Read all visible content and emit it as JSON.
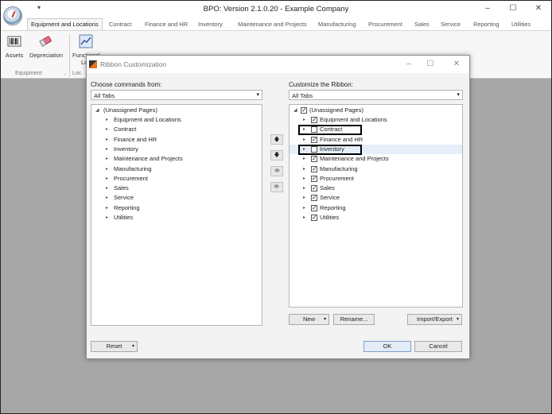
{
  "app": {
    "title": "BPO: Version 2.1.0.20 - Example Company",
    "qat_glyph": "▾",
    "minimize": "–",
    "maximize": "☐",
    "close": "✕"
  },
  "tabs": [
    "Equipment and Locations",
    "Contract",
    "Finance and HR",
    "Inventory",
    "Maintenance and Projects",
    "Manufacturing",
    "Procurement",
    "Sales",
    "Service",
    "Reporting",
    "Utilities"
  ],
  "ribbon": {
    "assets_label": "Assets",
    "depreciation_label": "Depreciation",
    "functional_label_1": "Functional",
    "functional_label_2": "Loc",
    "group_equipment": "Equipment",
    "group_loc": "Loc"
  },
  "dialog": {
    "title": "Ribbon Customization",
    "minimize": "–",
    "maximize": "☐",
    "close": "✕",
    "left_label": "Choose commands from:",
    "left_combo": "All Tabs",
    "right_label": "Customize the Ribbon:",
    "right_combo": "All Tabs",
    "combo_arrow": "▾",
    "left_tree": {
      "root": "(Unassigned Pages)",
      "items": [
        "Equipment and Locations",
        "Contract",
        "Finance and HR",
        "Inventory",
        "Maintenance and Projects",
        "Manufacturing",
        "Procurement",
        "Sales",
        "Service",
        "Reporting",
        "Utilities"
      ]
    },
    "right_tree": {
      "root": "(Unassigned Pages)",
      "root_checked": true,
      "items": [
        {
          "label": "Equipment and Locations",
          "checked": true
        },
        {
          "label": "Contract",
          "checked": false
        },
        {
          "label": "Finance and HR",
          "checked": true
        },
        {
          "label": "Inventory",
          "checked": false
        },
        {
          "label": "Maintenance and Projects",
          "checked": true
        },
        {
          "label": "Manufacturing",
          "checked": true
        },
        {
          "label": "Procurement",
          "checked": true
        },
        {
          "label": "Sales",
          "checked": true
        },
        {
          "label": "Service",
          "checked": true
        },
        {
          "label": "Reporting",
          "checked": true
        },
        {
          "label": "Utilities",
          "checked": true
        }
      ],
      "selected": "Inventory"
    },
    "move_up": "🡅",
    "move_down": "🡇",
    "move_left": "🡄",
    "move_right": "🡆",
    "new_button": "New",
    "rename_button": "Rename...",
    "import_export_button": "Import/Export",
    "reset_button": "Reset",
    "ok_button": "OK",
    "cancel_button": "Cancel",
    "dropdown_glyph": "▾"
  },
  "colors": {
    "selection": "#e5eef9",
    "workspace": "#a7a7a7",
    "highlight_box": "#000000"
  }
}
